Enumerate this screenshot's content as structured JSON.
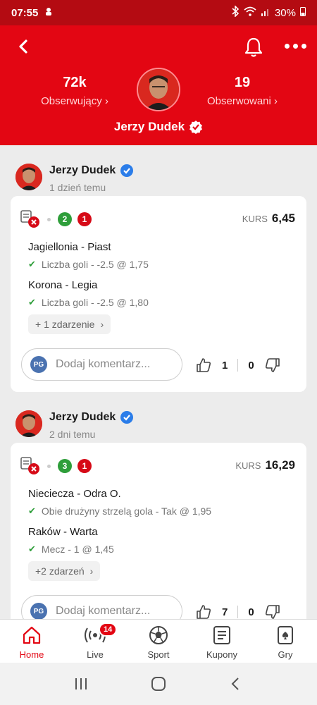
{
  "status_bar": {
    "time": "07:55",
    "battery": "30%"
  },
  "profile": {
    "followers_count": "72k",
    "followers_label": "Obserwujący",
    "following_count": "19",
    "following_label": "Obserwowani",
    "name": "Jerzy Dudek"
  },
  "posts": [
    {
      "author": "Jerzy Dudek",
      "time": "1 dzień temu",
      "won": "2",
      "lost": "1",
      "kurs_label": "KURS",
      "kurs_value": "6,45",
      "events": [
        {
          "match": "Jagiellonia - Piast",
          "bet": "Liczba goli - -2.5 @ 1,75"
        },
        {
          "match": "Korona - Legia",
          "bet": "Liczba goli - -2.5 @ 1,80"
        }
      ],
      "more_events": "+ 1 zdarzenie",
      "likes": "1",
      "dislikes": "0"
    },
    {
      "author": "Jerzy Dudek",
      "time": "2 dni temu",
      "won": "3",
      "lost": "1",
      "kurs_label": "KURS",
      "kurs_value": "16,29",
      "events": [
        {
          "match": "Nieciecza - Odra O.",
          "bet": "Obie drużyny strzelą gola - Tak @ 1,95"
        },
        {
          "match": "Raków - Warta",
          "bet": "Mecz - 1 @ 1,45"
        }
      ],
      "more_events": "+2 zdarzeń",
      "likes": "7",
      "dislikes": "0"
    }
  ],
  "comment": {
    "initials": "PG",
    "placeholder": "Dodaj komentarz..."
  },
  "nav": {
    "home": "Home",
    "live": "Live",
    "live_badge": "14",
    "sport": "Sport",
    "kupony": "Kupony",
    "gry": "Gry"
  },
  "colors": {
    "brand": "#e30613",
    "win": "#2e9e3a",
    "loss": "#d60a17"
  }
}
